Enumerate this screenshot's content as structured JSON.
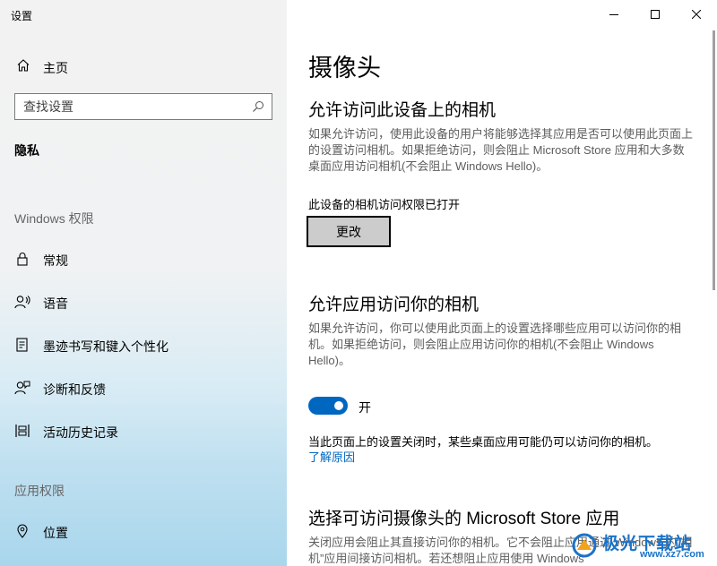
{
  "window": {
    "title": "设置"
  },
  "sidebar": {
    "home_label": "主页",
    "search_placeholder": "查找设置",
    "current_section": "隐私",
    "groups": [
      {
        "label": "Windows 权限",
        "items": [
          {
            "label": "常规",
            "icon": "lock-icon"
          },
          {
            "label": "语音",
            "icon": "speech-icon"
          },
          {
            "label": "墨迹书写和键入个性化",
            "icon": "inking-icon"
          },
          {
            "label": "诊断和反馈",
            "icon": "feedback-icon"
          },
          {
            "label": "活动历史记录",
            "icon": "activity-history-icon"
          }
        ]
      },
      {
        "label": "应用权限",
        "items": [
          {
            "label": "位置",
            "icon": "location-icon"
          }
        ]
      }
    ]
  },
  "main": {
    "title": "摄像头",
    "section1": {
      "heading": "允许访问此设备上的相机",
      "description": "如果允许访问，使用此设备的用户将能够选择其应用是否可以使用此页面上的设置访问相机。如果拒绝访问，则会阻止 Microsoft Store 应用和大多数桌面应用访问相机(不会阻止 Windows Hello)。",
      "status": "此设备的相机访问权限已打开",
      "button_label": "更改"
    },
    "section2": {
      "heading": "允许应用访问你的相机",
      "description": "如果允许访问，你可以使用此页面上的设置选择哪些应用可以访问你的相机。如果拒绝访问，则会阻止应用访问你的相机(不会阻止 Windows Hello)。",
      "toggle_state": "开",
      "toggle_on": true,
      "note": "当此页面上的设置关闭时，某些桌面应用可能仍可以访问你的相机。",
      "link": "了解原因"
    },
    "section3": {
      "heading": "选择可访问摄像头的 Microsoft Store 应用",
      "description": "关闭应用会阻止其直接访问你的相机。它不会阻止应用通过 Windows 的“相机”应用间接访问相机。若还想阻止应用使用 Windows"
    }
  },
  "watermark": {
    "text": "极光下载站",
    "sub": "www.xz7.com"
  },
  "colors": {
    "accent": "#0067c0",
    "button_bg": "#cccccc"
  }
}
